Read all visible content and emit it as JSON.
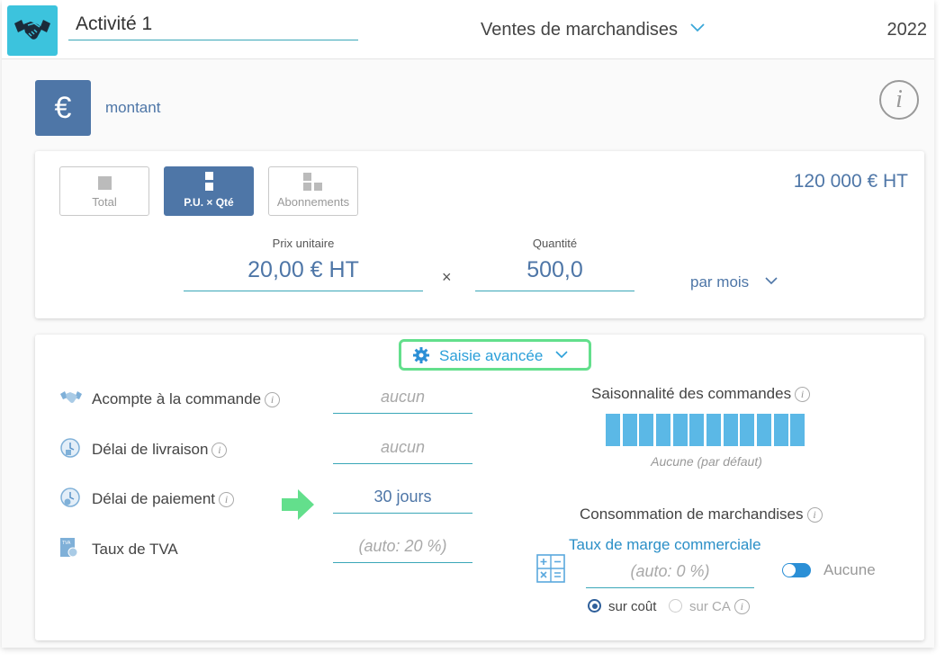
{
  "header": {
    "activity_name": "Activité 1",
    "category": "Ventes de marchandises",
    "year": "2022"
  },
  "montant": {
    "currency_symbol": "€",
    "label": "montant"
  },
  "pricing": {
    "modes": [
      {
        "label": "Total",
        "active": false
      },
      {
        "label": "P.U. × Qté",
        "active": true
      },
      {
        "label": "Abonnements",
        "active": false
      }
    ],
    "total": "120 000 € HT",
    "unit_price_label": "Prix unitaire",
    "unit_price": "20,00 € HT",
    "times_symbol": "×",
    "quantity_label": "Quantité",
    "quantity": "500,0",
    "period": "par mois"
  },
  "advanced": {
    "toggle_label": "Saisie avancée",
    "rows": [
      {
        "label": "Acompte à la commande",
        "value": "aucun",
        "placeholder": true
      },
      {
        "label": "Délai de livraison",
        "value": "aucun",
        "placeholder": true
      },
      {
        "label": "Délai de paiement",
        "value": "30 jours",
        "placeholder": false
      },
      {
        "label": "Taux de TVA",
        "value": "(auto: 20 %)",
        "placeholder": true
      }
    ],
    "seasonality": {
      "title": "Saisonnalité des commandes",
      "bar_count": 12,
      "caption": "Aucune (par défaut)"
    },
    "consumption": {
      "title": "Consommation de marchandises",
      "margin_label": "Taux de marge commerciale",
      "margin_value": "(auto: 0 %)",
      "toggle_label": "Aucune",
      "radio_options": [
        {
          "label": "sur coût",
          "selected": true
        },
        {
          "label": "sur CA",
          "selected": false
        }
      ]
    }
  },
  "colors": {
    "brand_teal": "#3cc3dd",
    "primary_blue": "#4e76a7",
    "link_blue": "#2b9fd9",
    "highlight_green": "#63df8c",
    "season_bar": "#5bb8e6"
  }
}
